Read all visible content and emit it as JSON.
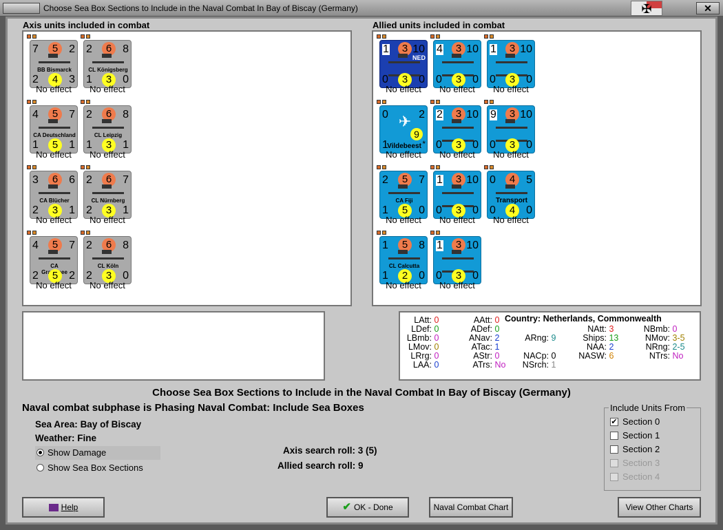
{
  "window": {
    "title": "Choose Sea Box Sections to Include in the Naval Combat In Bay of Biscay (Germany)"
  },
  "axis": {
    "header": "Axis units included in combat",
    "units": [
      {
        "tl": "7",
        "tc": "5",
        "tr": "2",
        "bl": "2",
        "bc": "4",
        "br": "3",
        "name": "BB Bismarck",
        "effect": "No effect"
      },
      {
        "tl": "2",
        "tc": "6",
        "tr": "8",
        "bl": "1",
        "bc": "3",
        "br": "0",
        "name": "CL Königsberg",
        "effect": "No effect"
      },
      {
        "tl": "4",
        "tc": "5",
        "tr": "7",
        "bl": "1",
        "bc": "5",
        "br": "1",
        "name": "CA Deutschland",
        "effect": "No effect"
      },
      {
        "tl": "2",
        "tc": "6",
        "tr": "8",
        "bl": "1",
        "bc": "3",
        "br": "1",
        "name": "CL Leipzig",
        "effect": "No effect"
      },
      {
        "tl": "3",
        "tc": "6",
        "tr": "6",
        "bl": "2",
        "bc": "3",
        "br": "1",
        "name": "CA Blücher",
        "effect": "No effect"
      },
      {
        "tl": "2",
        "tc": "6",
        "tr": "7",
        "bl": "2",
        "bc": "3",
        "br": "1",
        "name": "CL Nürnberg",
        "effect": "No effect"
      },
      {
        "tl": "4",
        "tc": "5",
        "tr": "7",
        "bl": "2",
        "bc": "5",
        "br": "2",
        "name": "CA\nGraf Spee",
        "effect": "No effect"
      },
      {
        "tl": "2",
        "tc": "6",
        "tr": "8",
        "bl": "2",
        "bc": "3",
        "br": "0",
        "name": "CL Köln",
        "effect": "No effect"
      }
    ]
  },
  "allied": {
    "header": "Allied units included in combat",
    "units": [
      {
        "tl": "1",
        "tc": "3",
        "tr": "10",
        "bl": "0",
        "bc": "3",
        "br": "0",
        "name": "",
        "ned": "NED",
        "effect": "No effect"
      },
      {
        "tl": "4",
        "tc": "3",
        "tr": "10",
        "bl": "0",
        "bc": "3",
        "br": "0",
        "name": "",
        "effect": "No effect"
      },
      {
        "tl": "1",
        "tc": "3",
        "tr": "10",
        "bl": "0",
        "bc": "3",
        "br": "0",
        "name": "",
        "effect": "No effect"
      },
      {
        "tl": "0",
        "tc": "",
        "tr": "2",
        "bl": "1",
        "bc": "",
        "br": "",
        "name": "Vildebeest",
        "nine": "9",
        "star": "*",
        "effect": "No effect"
      },
      {
        "tl": "2",
        "tc": "3",
        "tr": "10",
        "bl": "0",
        "bc": "3",
        "br": "0",
        "name": "",
        "effect": "No effect"
      },
      {
        "tl": "9",
        "tc": "3",
        "tr": "10",
        "bl": "0",
        "bc": "3",
        "br": "0",
        "name": "",
        "effect": "No effect"
      },
      {
        "tl": "2",
        "tc": "5",
        "tr": "7",
        "bl": "1",
        "bc": "5",
        "br": "0",
        "name": "CA Fiji",
        "effect": "No effect"
      },
      {
        "tl": "1",
        "tc": "3",
        "tr": "10",
        "bl": "0",
        "bc": "3",
        "br": "0",
        "name": "",
        "effect": "No effect"
      },
      {
        "tl": "0",
        "tc": "4",
        "tr": "5",
        "bl": "0",
        "bc": "4",
        "br": "0",
        "name": "Transport",
        "effect": "No effect"
      },
      {
        "tl": "1",
        "tc": "5",
        "tr": "8",
        "bl": "1",
        "bc": "2",
        "br": "0",
        "name": "CL Calcutta",
        "effect": "No effect"
      },
      {
        "tl": "1",
        "tc": "3",
        "tr": "10",
        "bl": "0",
        "bc": "3",
        "br": "0",
        "name": "",
        "effect": "No effect"
      }
    ]
  },
  "stats": {
    "country_label": "Country:",
    "country": "Netherlands, Commonwealth",
    "cols": [
      [
        {
          "k": "LAtt:",
          "v": "0",
          "c": "#e02020"
        },
        {
          "k": "LDef:",
          "v": "0",
          "c": "#1a9e1a"
        },
        {
          "k": "LBmb:",
          "v": "0",
          "c": "#c020c0"
        },
        {
          "k": "LMov:",
          "v": "0",
          "c": "#a08000"
        },
        {
          "k": "LRrg:",
          "v": "0",
          "c": "#c020c0"
        },
        {
          "k": "LAA:",
          "v": "0",
          "c": "#1a3fd0"
        }
      ],
      [
        {
          "k": "AAtt:",
          "v": "0",
          "c": "#e02020"
        },
        {
          "k": "ADef:",
          "v": "0",
          "c": "#1a9e1a"
        },
        {
          "k": "ANav:",
          "v": "2",
          "c": "#1a3fd0"
        },
        {
          "k": "ATac:",
          "v": "1",
          "c": "#1a3fd0"
        },
        {
          "k": "AStr:",
          "v": "0",
          "c": "#c020c0"
        },
        {
          "k": "ATrs:",
          "v": "No",
          "c": "#c020c0"
        }
      ],
      [
        {
          "k": "ARng:",
          "v": "9",
          "c": "#1a8a8a"
        },
        {
          "k": "NACp:",
          "v": "0",
          "c": "#000"
        },
        {
          "k": "NSrch:",
          "v": "1",
          "c": "#888"
        }
      ],
      [
        {
          "k": "NAtt:",
          "v": "3",
          "c": "#e02020"
        },
        {
          "k": "Ships:",
          "v": "13",
          "c": "#1a9e1a"
        },
        {
          "k": "NAA:",
          "v": "2",
          "c": "#1a3fd0"
        },
        {
          "k": "NASW:",
          "v": "6",
          "c": "#d08000"
        }
      ],
      [
        {
          "k": "NBmb:",
          "v": "0",
          "c": "#c020c0"
        },
        {
          "k": "NMov:",
          "v": "3-5",
          "c": "#a08000"
        },
        {
          "k": "NRng:",
          "v": "2-5",
          "c": "#1a8a8a"
        },
        {
          "k": "NTrs:",
          "v": "No",
          "c": "#c020c0"
        }
      ]
    ]
  },
  "main": {
    "title": "Choose Sea Box Sections to Include in the Naval Combat In Bay of Biscay (Germany)",
    "subphase": "Naval combat subphase is Phasing Naval Combat: Include Sea Boxes",
    "sea_area_label": "Sea Area:",
    "sea_area": "Bay of Biscay",
    "weather_label": "Weather:",
    "weather": "Fine",
    "radio_damage": "Show Damage",
    "radio_sections": "Show Sea Box Sections",
    "axis_roll": "Axis search roll: 3 (5)",
    "allied_roll": "Allied search roll: 9"
  },
  "include": {
    "legend": "Include Units From",
    "sections": [
      {
        "label": "Section 0",
        "checked": true,
        "enabled": true
      },
      {
        "label": "Section 1",
        "checked": false,
        "enabled": true
      },
      {
        "label": "Section 2",
        "checked": false,
        "enabled": true
      },
      {
        "label": "Section 3",
        "checked": false,
        "enabled": false
      },
      {
        "label": "Section 4",
        "checked": false,
        "enabled": false
      }
    ]
  },
  "buttons": {
    "help": "Help",
    "ok": "OK - Done",
    "chart": "Naval Combat Chart",
    "other": "View Other Charts"
  }
}
